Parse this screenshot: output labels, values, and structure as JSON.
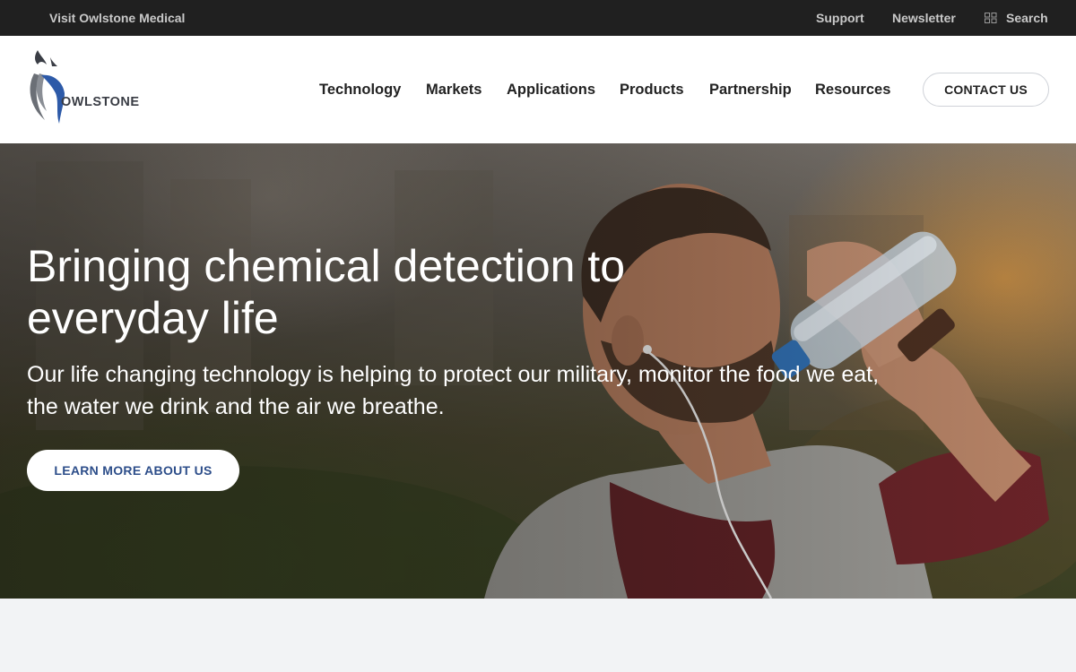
{
  "topbar": {
    "visit_label": "Visit Owlstone Medical",
    "support_label": "Support",
    "newsletter_label": "Newsletter",
    "search_label": "Search",
    "search_icon": "grid-search-icon"
  },
  "header": {
    "logo_text": "OWLSTONE",
    "nav": {
      "technology": "Technology",
      "markets": "Markets",
      "applications": "Applications",
      "products": "Products",
      "partnership": "Partnership",
      "resources": "Resources"
    },
    "contact_label": "CONTACT US"
  },
  "hero": {
    "title": "Bringing chemical detection to everyday life",
    "subtitle": "Our life changing technology is helping to protect our military, monitor the food we eat, the water we drink and the air we breathe.",
    "cta_label": "LEARN MORE ABOUT US"
  },
  "colors": {
    "topbar_bg": "#202020",
    "brand_blue": "#2d4e8a",
    "logo_gray": "#3a3d45"
  }
}
